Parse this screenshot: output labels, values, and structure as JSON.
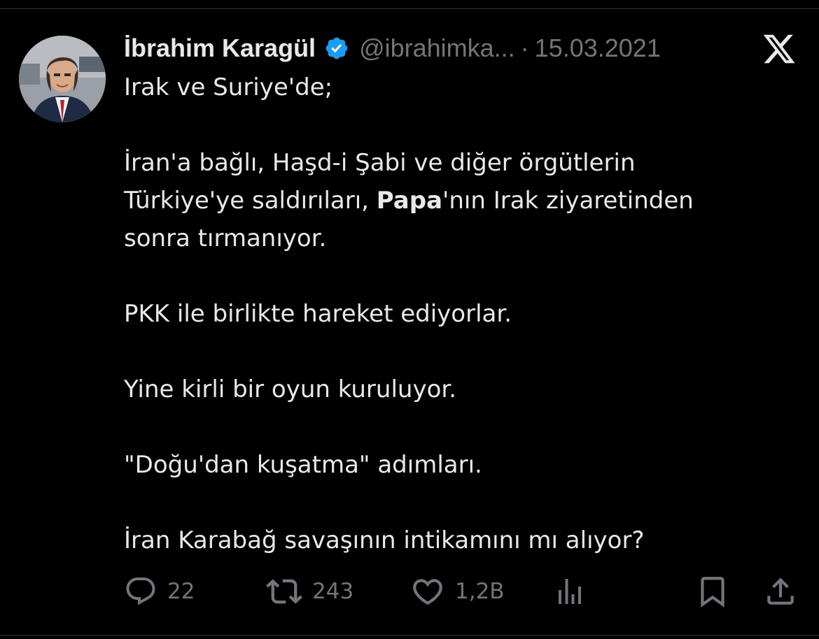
{
  "author": {
    "display_name": "İbrahim Karagül",
    "handle": "@ibrahimka...",
    "separator": "·",
    "date": "15.03.2021",
    "verified_icon": "verified-badge-icon"
  },
  "platform_logo": "x-logo-icon",
  "tweet": {
    "line_1": "Irak ve Suriye'de;",
    "line_2": "İran'a bağlı, Haşd-i Şabi ve diğer örgütlerin",
    "line_3_pre": "Türkiye'ye saldırıları, ",
    "line_3_bold": "Papa",
    "line_3_post": "'nın Irak ziyaretinden",
    "line_4": "sonra tırmanıyor.",
    "line_5": "PKK ile birlikte hareket ediyorlar.",
    "line_6": "Yine kirli bir oyun kuruluyor.",
    "line_7": "\"Doğu'dan kuşatma\" adımları.",
    "line_8": "İran Karabağ savaşının intikamını mı alıyor?"
  },
  "actions": {
    "reply": {
      "icon": "reply-icon",
      "count": "22"
    },
    "repost": {
      "icon": "repost-icon",
      "count": "243"
    },
    "like": {
      "icon": "heart-icon",
      "count": "1,2B"
    },
    "views": {
      "icon": "views-chart-icon"
    },
    "bookmark": {
      "icon": "bookmark-icon"
    },
    "share": {
      "icon": "share-icon"
    }
  },
  "colors": {
    "background": "#000000",
    "text": "#e7e9ea",
    "muted": "#71767b",
    "verified": "#1d9bf0"
  }
}
